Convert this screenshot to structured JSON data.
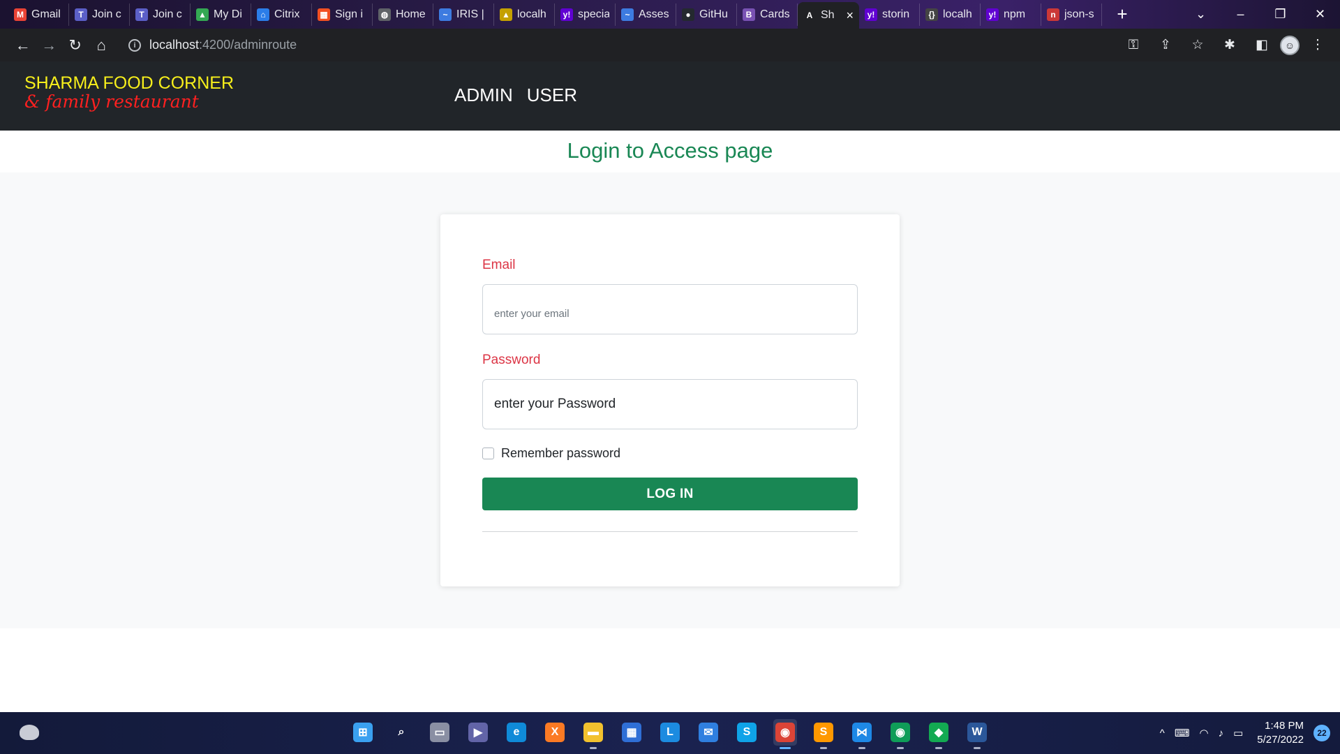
{
  "browser": {
    "tabs": [
      {
        "label": "Gmail",
        "icon": "gmail-icon",
        "color": "#ea4335",
        "glyph": "M"
      },
      {
        "label": "Join c",
        "icon": "teams-icon",
        "color": "#5b5fc7",
        "glyph": "T"
      },
      {
        "label": "Join c",
        "icon": "teams-icon",
        "color": "#5b5fc7",
        "glyph": "T"
      },
      {
        "label": "My Di",
        "icon": "drive-icon",
        "color": "#34a853",
        "glyph": "▲"
      },
      {
        "label": "Citrix",
        "icon": "citrix-icon",
        "color": "#2b7de9",
        "glyph": "⌂"
      },
      {
        "label": "Sign i",
        "icon": "microsoft-icon",
        "color": "#f25022",
        "glyph": "▦"
      },
      {
        "label": "Home",
        "icon": "globe-icon",
        "color": "#5f6368",
        "glyph": "◍"
      },
      {
        "label": "IRIS | ",
        "icon": "iris-icon",
        "color": "#3d7be0",
        "glyph": "~"
      },
      {
        "label": "localh",
        "icon": "angular-icon",
        "color": "#c4a000",
        "glyph": "▲"
      },
      {
        "label": "specia",
        "icon": "yahoo-icon",
        "color": "#6001d2",
        "glyph": "y!"
      },
      {
        "label": "Asses",
        "icon": "iris-icon",
        "color": "#3d7be0",
        "glyph": "~"
      },
      {
        "label": "GitHu",
        "icon": "github-icon",
        "color": "#24292f",
        "glyph": "●"
      },
      {
        "label": "Cards",
        "icon": "bootstrap-icon",
        "color": "#7952b3",
        "glyph": "B"
      },
      {
        "label": "Sh",
        "icon": "angular-tab-icon",
        "color": "#202124",
        "glyph": "A",
        "active": true
      },
      {
        "label": "storin",
        "icon": "yahoo-icon",
        "color": "#6001d2",
        "glyph": "y!"
      },
      {
        "label": "localh",
        "icon": "json-server-icon",
        "color": "#444444",
        "glyph": "{}"
      },
      {
        "label": "npm",
        "icon": "yahoo-icon",
        "color": "#6001d2",
        "glyph": "y!"
      },
      {
        "label": "json-s",
        "icon": "npm-icon",
        "color": "#cb3837",
        "glyph": "n"
      }
    ],
    "url_host": "localhost",
    "url_path": ":4200/adminroute"
  },
  "app": {
    "brand_title": "SHARMA FOOD CORNER",
    "brand_subtitle": "& family restaurant",
    "nav": [
      "ADMIN",
      "USER"
    ],
    "page_title": "Login to Access page"
  },
  "login_form": {
    "email_label": "Email",
    "email_placeholder": "enter your email",
    "password_label": "Password",
    "password_placeholder": "enter your Password",
    "remember_label": "Remember password",
    "remember_checked": false,
    "submit_label": "LOG IN"
  },
  "colors": {
    "brand_title": "#f7ef1b",
    "brand_subtitle": "#ff2020",
    "navbar_bg": "#212529",
    "accent_green": "#198754",
    "label_red": "#dc3545"
  },
  "taskbar": {
    "apps": [
      {
        "icon": "windows-start-icon",
        "color": "#3aa0f0",
        "glyph": "⊞"
      },
      {
        "icon": "search-icon",
        "color": "transparent",
        "glyph": "⌕"
      },
      {
        "icon": "task-view-icon",
        "color": "#8a8fa3",
        "glyph": "▭"
      },
      {
        "icon": "teams-chat-icon",
        "color": "#6264a7",
        "glyph": "▶"
      },
      {
        "icon": "edge-icon",
        "color": "#0f8ad8",
        "glyph": "e"
      },
      {
        "icon": "xampp-icon",
        "color": "#fb7a24",
        "glyph": "X"
      },
      {
        "icon": "file-explorer-icon",
        "color": "#f2c12e",
        "glyph": "▬",
        "running": true
      },
      {
        "icon": "microsoft-store-icon",
        "color": "#2f6fd6",
        "glyph": "▦"
      },
      {
        "icon": "l-app-icon",
        "color": "#1c8be0",
        "glyph": "L"
      },
      {
        "icon": "mail-icon",
        "color": "#2f7fe0",
        "glyph": "✉"
      },
      {
        "icon": "skype-icon",
        "color": "#0fa3e8",
        "glyph": "S"
      },
      {
        "icon": "chrome-profile-icon",
        "color": "#db4437",
        "glyph": "◉",
        "focused": true
      },
      {
        "icon": "sublime-text-icon",
        "color": "#ff9800",
        "glyph": "S",
        "running": true
      },
      {
        "icon": "vscode-icon",
        "color": "#1e88e5",
        "glyph": "⋈",
        "running": true
      },
      {
        "icon": "chrome-icon",
        "color": "#0f9d58",
        "glyph": "◉",
        "running": true
      },
      {
        "icon": "mongodb-compass-icon",
        "color": "#13aa52",
        "glyph": "◆",
        "running": true
      },
      {
        "icon": "word-icon",
        "color": "#2b579a",
        "glyph": "W",
        "running": true
      }
    ],
    "time": "1:48 PM",
    "date": "5/27/2022",
    "notification_count": "22"
  }
}
